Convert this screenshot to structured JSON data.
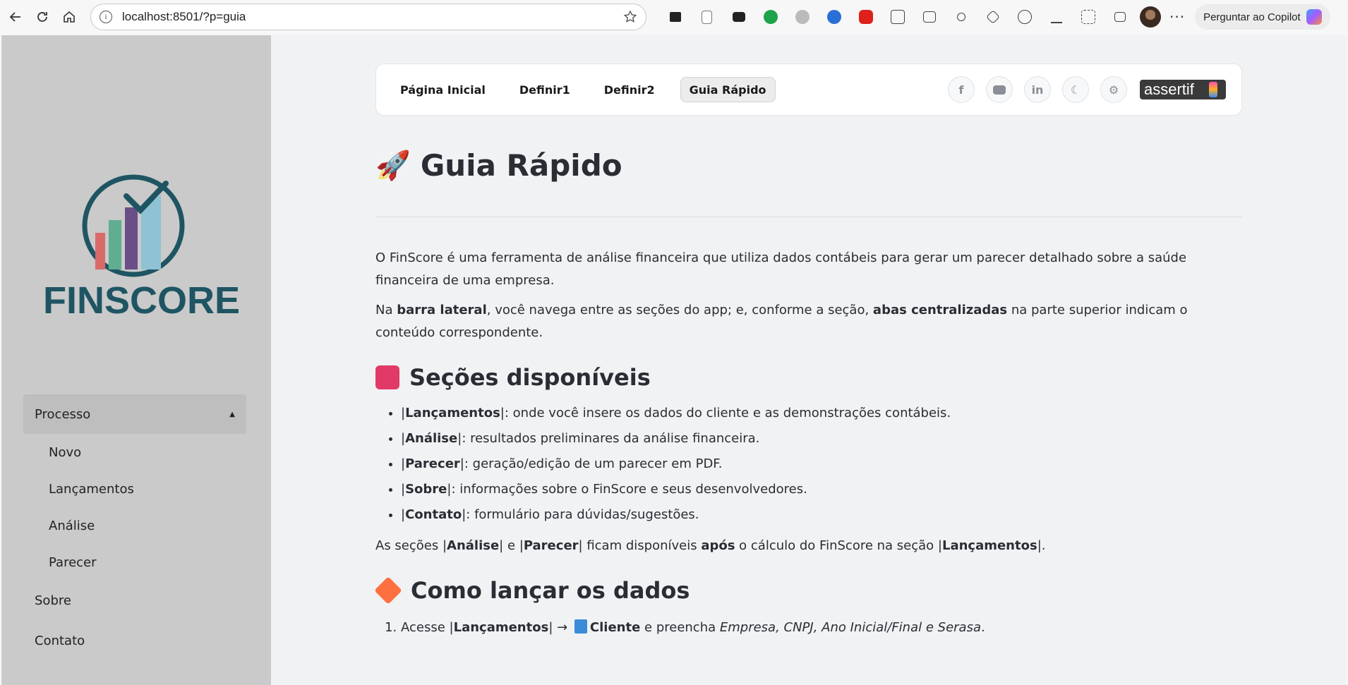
{
  "browser": {
    "url": "localhost:8501/?p=guia",
    "copilot_label": "Perguntar ao Copilot"
  },
  "sidebar": {
    "logo_text": "FINSCORE",
    "menu": {
      "group_label": "Processo",
      "group_items": [
        "Novo",
        "Lançamentos",
        "Análise",
        "Parecer"
      ],
      "top_items": [
        "Sobre",
        "Contato"
      ]
    }
  },
  "topnav": {
    "tabs": [
      "Página Inicial",
      "Definir1",
      "Definir2",
      "Guia Rápido"
    ],
    "active_tab": "Guia Rápido",
    "social_icons": [
      "facebook-icon",
      "youtube-icon",
      "linkedin-icon",
      "moon-icon",
      "gear-icon"
    ],
    "brand": "assertif"
  },
  "content": {
    "title": "Guia Rápido",
    "intro": "O FinScore é uma ferramenta de análise financeira que utiliza dados contábeis para gerar um parecer detalhado sobre a saúde financeira de uma empresa.",
    "nav_p": {
      "a": "Na ",
      "b1": "barra lateral",
      "c": ", você navega entre as seções do app; e, conforme a seção, ",
      "b2": "abas centralizadas",
      "d": " na parte superior indicam o conteúdo correspondente."
    },
    "sections_title": "Seções disponíveis",
    "sections": [
      {
        "name": "Lançamentos",
        "desc": ": onde você insere os dados do cliente e as demonstrações contábeis."
      },
      {
        "name": "Análise",
        "desc": ": resultados preliminares da análise financeira."
      },
      {
        "name": "Parecer",
        "desc": ": geração/edição de um parecer em PDF."
      },
      {
        "name": "Sobre",
        "desc": ": informações sobre o FinScore e seus desenvolvedores."
      },
      {
        "name": "Contato",
        "desc": ": formulário para dúvidas/sugestões."
      }
    ],
    "availability": {
      "a": "As seções |",
      "b1": "Análise",
      "c": "| e |",
      "b2": "Parecer",
      "d": "| ficam disponíveis ",
      "b3": "após",
      "e": " o cálculo do FinScore na seção |",
      "b4": "Lançamentos",
      "f": "|."
    },
    "how_title": "Como lançar os dados",
    "step1": {
      "a": "Acesse |",
      "b1": "Lançamentos",
      "c": "| → ",
      "b2": "Cliente",
      "d": " e preencha ",
      "i1": "Empresa, CNPJ, Ano Inicial/Final e Serasa",
      "e": "."
    }
  }
}
